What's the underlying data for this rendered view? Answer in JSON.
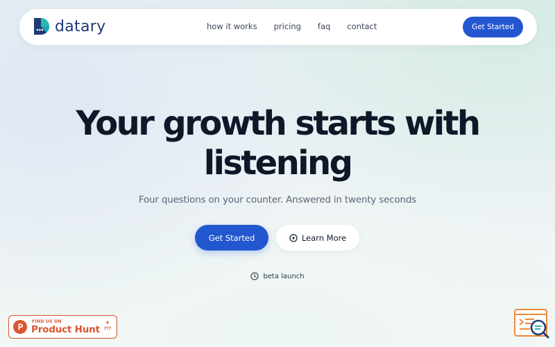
{
  "nav": {
    "brand": "datary",
    "links": [
      "how it works",
      "pricing",
      "faq",
      "contact"
    ],
    "cta": "Get Started"
  },
  "hero": {
    "title_line1": "Your growth starts with",
    "title_line2": "listening",
    "subtitle": "Four questions on your counter. Answered in twenty seconds",
    "primary_cta": "Get Started",
    "secondary_cta": "Learn More",
    "secondary_icon": "play-circle-icon",
    "beta_label": "beta launch",
    "beta_icon": "clock-icon"
  },
  "product_hunt": {
    "find_us": "FIND US ON",
    "name": "Product Hunt",
    "vote_icon": "▲",
    "count": "???"
  },
  "corner_widget": {
    "icon": "chat-search-icon"
  },
  "colors": {
    "accent": "#2357cf",
    "brand_text": "#1f3a74",
    "logo_teal": "#2bb8b4",
    "product_hunt": "#d9552f",
    "widget_orange": "#f08a3c"
  }
}
